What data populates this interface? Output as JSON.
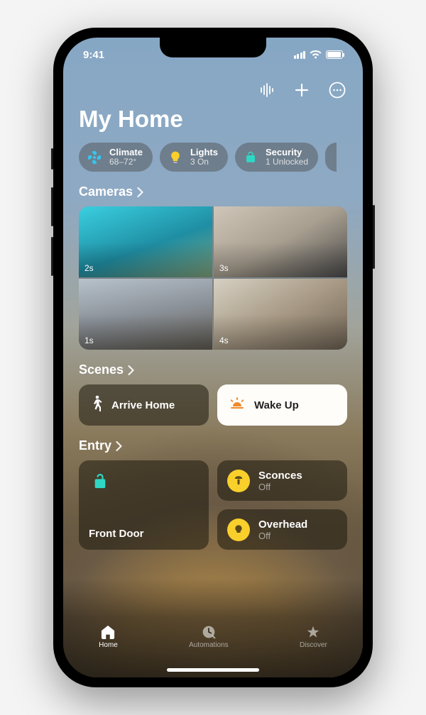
{
  "status": {
    "time": "9:41"
  },
  "title": "My Home",
  "chips": [
    {
      "icon": "fan-icon",
      "label": "Climate",
      "sub": "68–72°",
      "color": "#35c6ef"
    },
    {
      "icon": "bulb-icon",
      "label": "Lights",
      "sub": "3 On",
      "color": "#f9cf2b"
    },
    {
      "icon": "lock-icon",
      "label": "Security",
      "sub": "1 Unlocked",
      "color": "#2fd8c5"
    }
  ],
  "sections": {
    "cameras": {
      "title": "Cameras",
      "items": [
        "2s",
        "3s",
        "1s",
        "4s"
      ]
    },
    "scenes": {
      "title": "Scenes",
      "items": [
        {
          "label": "Arrive Home",
          "icon": "walk-icon",
          "variant": "dark"
        },
        {
          "label": "Wake Up",
          "icon": "sunrise-icon",
          "variant": "light"
        }
      ]
    },
    "entry": {
      "title": "Entry",
      "items": [
        {
          "name": "Front Door",
          "icon": "lock-icon",
          "iconColor": "#2fd8c5"
        },
        {
          "name": "Sconces",
          "state": "Off",
          "icon": "lamp-icon",
          "iconColor": "#f9cf2b"
        },
        {
          "name": "Overhead",
          "state": "Off",
          "icon": "bulb-icon",
          "iconColor": "#f9cf2b"
        }
      ]
    }
  },
  "tabs": [
    {
      "label": "Home",
      "icon": "house-icon",
      "active": true
    },
    {
      "label": "Automations",
      "icon": "clock-icon",
      "active": false
    },
    {
      "label": "Discover",
      "icon": "star-icon",
      "active": false
    }
  ]
}
